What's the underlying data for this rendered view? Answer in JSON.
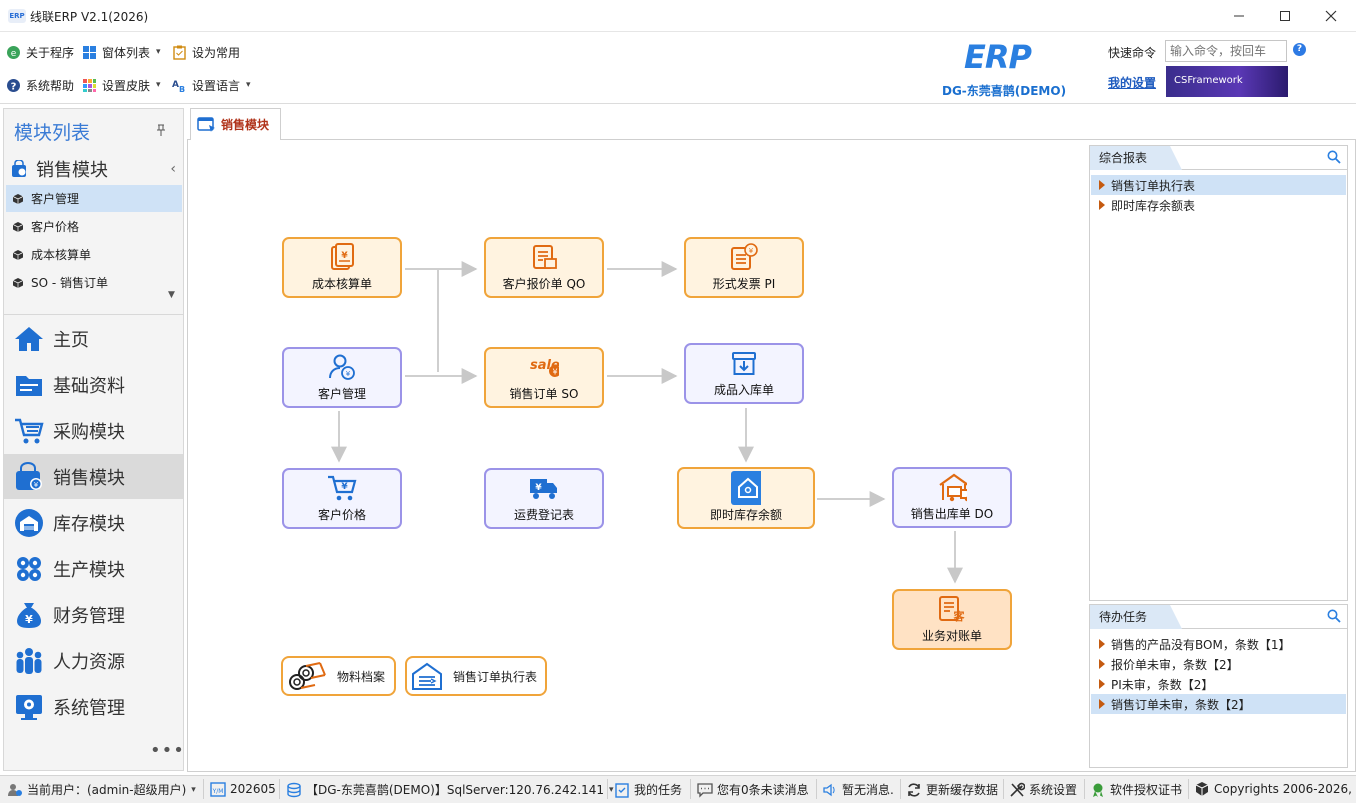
{
  "window": {
    "title": "线联ERP V2.1(2026)",
    "logo_text": "ERP"
  },
  "toolbar": {
    "about": "关于程序",
    "window_list": "窗体列表",
    "set_common": "设为常用",
    "help": "系统帮助",
    "skin": "设置皮肤",
    "language": "设置语言"
  },
  "brand": {
    "logo_text": "ERP",
    "company": "DG-东莞喜鹊(DEMO)"
  },
  "quick_command": {
    "label": "快速命令",
    "placeholder": "输入命令，按回车",
    "my_settings": "我的设置",
    "banner": "CSFramework"
  },
  "left_panel": {
    "title": "模块列表",
    "current_module": "销售模块",
    "sub_items": [
      "客户管理",
      "客户价格",
      "成本核算单",
      "SO - 销售订单"
    ],
    "nav": [
      "主页",
      "基础资料",
      "采购模块",
      "销售模块",
      "库存模块",
      "生产模块",
      "财务管理",
      "人力资源",
      "系统管理"
    ],
    "more": "•••"
  },
  "tab": {
    "label": "销售模块"
  },
  "flow": {
    "cost": "成本核算单",
    "quote": "客户报价单 QO",
    "invoice": "形式发票 PI",
    "customer": "客户管理",
    "sales_order": "销售订单 SO",
    "inbound": "成品入库单",
    "price": "客户价格",
    "freight": "运费登记表",
    "stock": "即时库存余额",
    "outbound": "销售出库单 DO",
    "reconcile": "业务对账单",
    "material": "物料档案",
    "order_report": "销售订单执行表"
  },
  "reports": {
    "title": "综合报表",
    "items": [
      "销售订单执行表",
      "即时库存余额表"
    ]
  },
  "todo": {
    "title": "待办任务",
    "items": [
      "销售的产品没有BOM，条数【1】",
      "报价单未审，条数【2】",
      "PI未审，条数【2】",
      "销售订单未审，条数【2】"
    ]
  },
  "status": {
    "user": "当前用户：(admin-超级用户)",
    "period": "202605",
    "db": "【DG-东莞喜鹊(DEMO)】SqlServer:120.76.242.141",
    "tasks": "我的任务",
    "unread": "您有0条未读消息",
    "msg": "暂无消息.",
    "cache": "更新缓存数据",
    "settings": "系统设置",
    "license": "软件授权证书",
    "copyright": "Copyrights 2006-2026,"
  }
}
